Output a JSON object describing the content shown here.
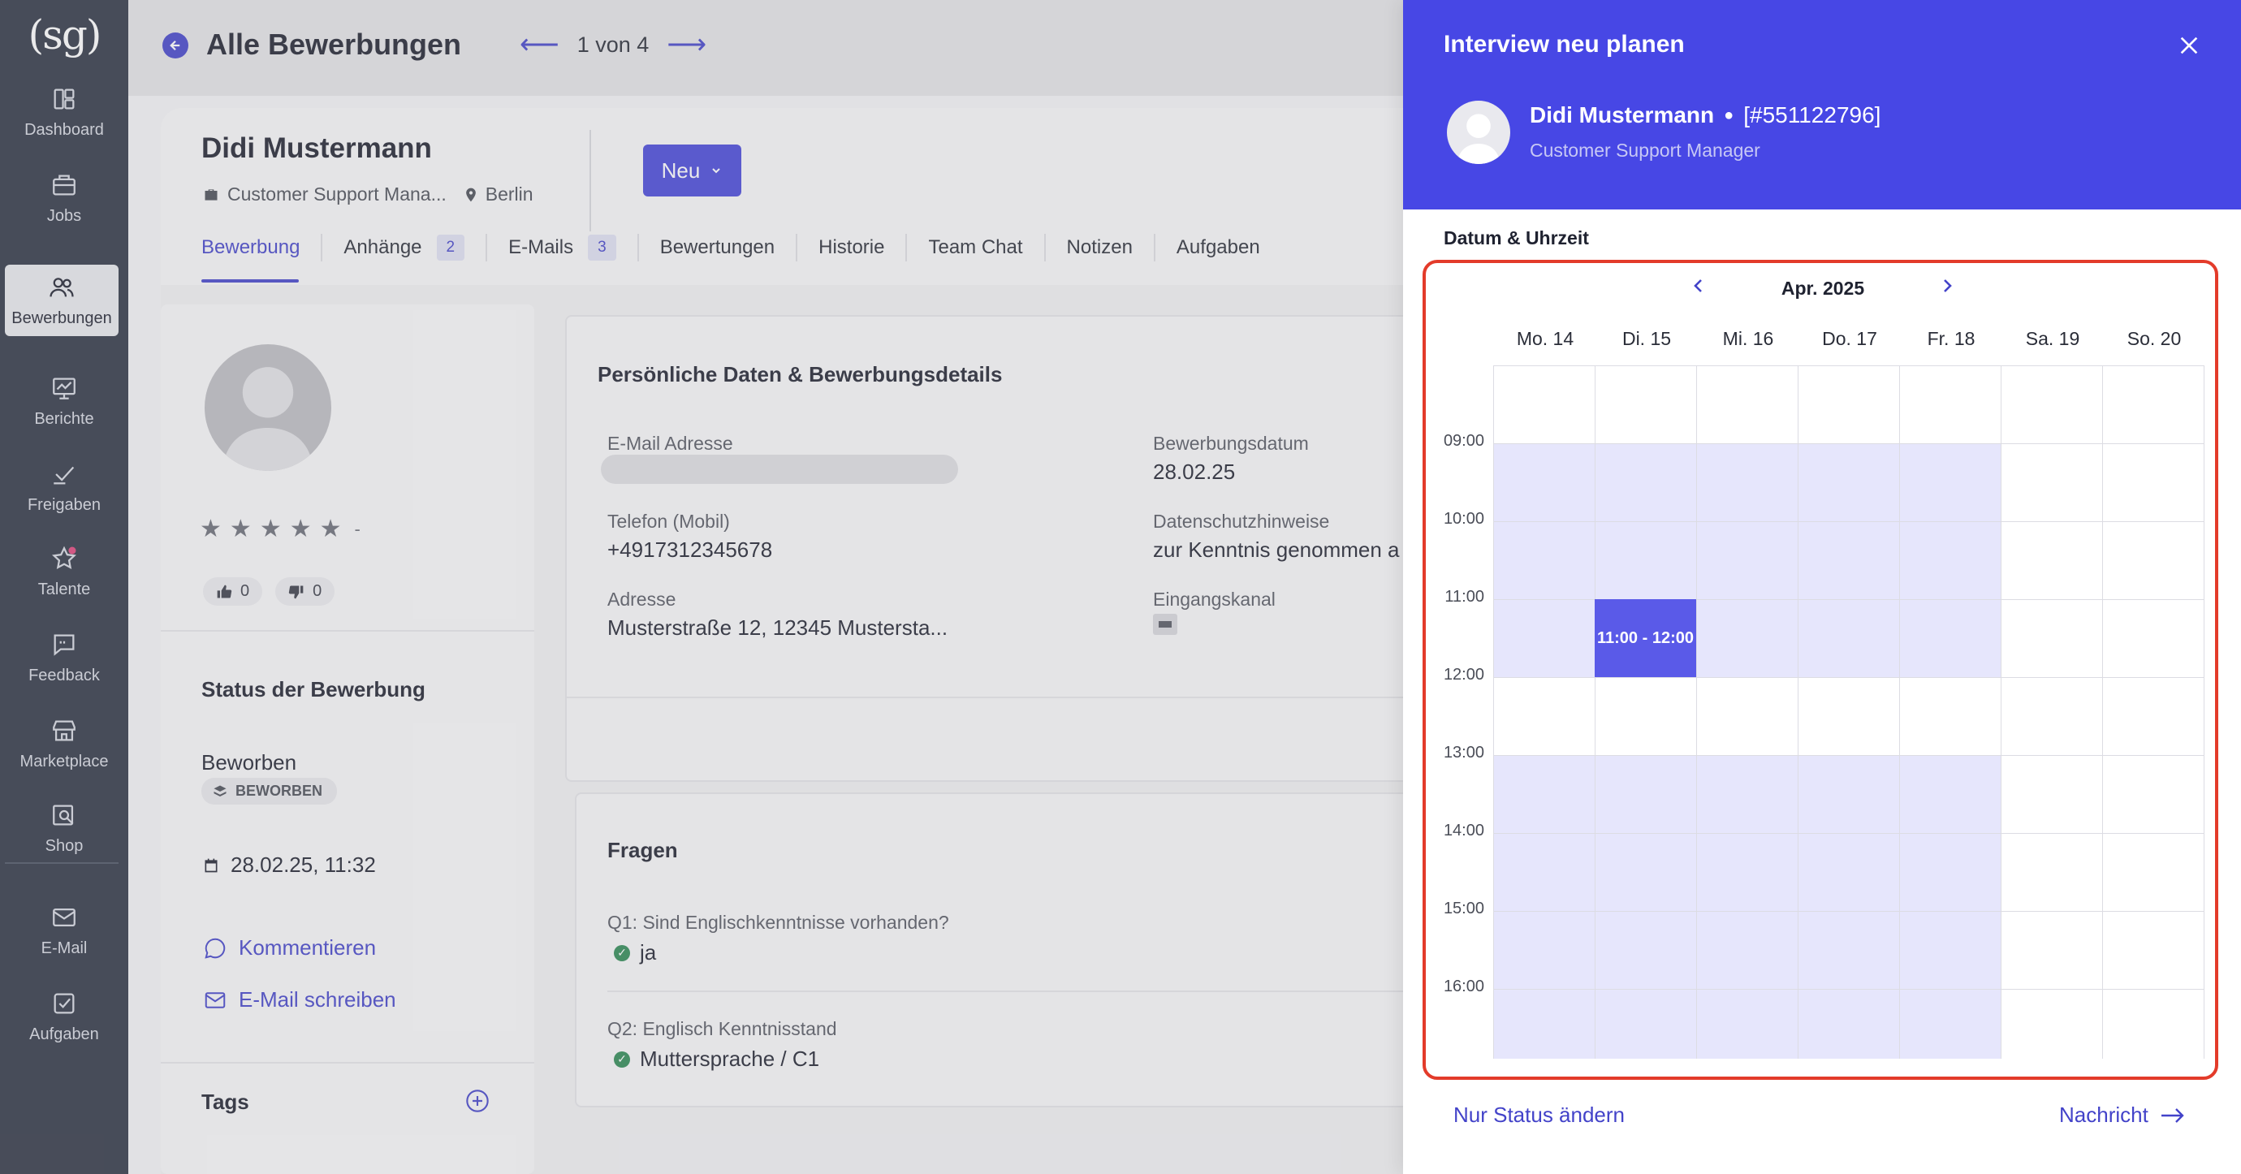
{
  "sidebar": {
    "logo": "(sg)",
    "items": [
      {
        "label": "Dashboard",
        "icon": "dashboard-icon"
      },
      {
        "label": "Jobs",
        "icon": "briefcase-icon"
      },
      {
        "label": "Bewerbungen",
        "icon": "users-icon",
        "active": true
      },
      {
        "label": "Berichte",
        "icon": "chart-icon"
      },
      {
        "label": "Freigaben",
        "icon": "approval-icon"
      },
      {
        "label": "Talente",
        "icon": "star-icon"
      },
      {
        "label": "Feedback",
        "icon": "feedback-icon"
      },
      {
        "label": "Marketplace",
        "icon": "store-icon"
      },
      {
        "label": "Shop",
        "icon": "shop-search-icon"
      },
      {
        "label": "E-Mail",
        "icon": "mail-icon"
      },
      {
        "label": "Aufgaben",
        "icon": "task-icon"
      }
    ]
  },
  "header": {
    "title": "Alle Bewerbungen",
    "pager": "1 von 4"
  },
  "candidate": {
    "name": "Didi Mustermann",
    "job": "Customer Support Mana...",
    "location": "Berlin",
    "status_button": "Neu",
    "tabs": [
      {
        "label": "Bewerbung",
        "count": ""
      },
      {
        "label": "Anhänge",
        "count": "2"
      },
      {
        "label": "E-Mails",
        "count": "3"
      },
      {
        "label": "Bewertungen",
        "count": ""
      },
      {
        "label": "Historie",
        "count": ""
      },
      {
        "label": "Team Chat",
        "count": ""
      },
      {
        "label": "Notizen",
        "count": ""
      },
      {
        "label": "Aufgaben",
        "count": ""
      }
    ],
    "rating_text": "-",
    "thumbs_up": "0",
    "thumbs_down": "0"
  },
  "status_section": {
    "title": "Status der Bewerbung",
    "status": "Beworben",
    "badge": "BEWORBEN",
    "date": "28.02.25, 11:32",
    "comment_link": "Kommentieren",
    "email_link": "E-Mail schreiben"
  },
  "tags": {
    "title": "Tags"
  },
  "details": {
    "title": "Persönliche Daten & Bewerbungsdetails",
    "email_label": "E-Mail Adresse",
    "phone_label": "Telefon (Mobil)",
    "phone": "+4917312345678",
    "address_label": "Adresse",
    "address": "Musterstraße 12, 12345 Mustersta...",
    "apply_date_label": "Bewerbungsdatum",
    "apply_date": "28.02.25",
    "privacy_label": "Datenschutzhinweise",
    "privacy": "zur Kenntnis genommen a",
    "channel_label": "Eingangskanal"
  },
  "questions": {
    "title": "Fragen",
    "items": [
      {
        "q": "Q1: Sind Englischkenntnisse vorhanden?",
        "a": "ja"
      },
      {
        "q": "Q2: Englisch Kenntnisstand",
        "a": "Muttersprache / C1"
      }
    ]
  },
  "drawer": {
    "title": "Interview neu planen",
    "candidate_name": "Didi Mustermann",
    "candidate_id": "[#551122796]",
    "candidate_role": "Customer Support Manager",
    "section_label": "Datum & Uhrzeit",
    "month": "Apr. 2025",
    "days": [
      "Mo. 14",
      "Di. 15",
      "Mi. 16",
      "Do. 17",
      "Fr. 18",
      "Sa. 19",
      "So. 20"
    ],
    "times": [
      "09:00",
      "10:00",
      "11:00",
      "12:00",
      "13:00",
      "14:00",
      "15:00",
      "16:00"
    ],
    "event_label": "11:00 - 12:00",
    "status_only": "Nur Status ändern",
    "next": "Nachricht"
  },
  "colors": {
    "accent": "#4747e5",
    "sidebar": "#2f3544",
    "available_slot": "#e6e6fc",
    "selected_slot": "#5a5ae8",
    "highlight_border": "#e33b2a"
  }
}
